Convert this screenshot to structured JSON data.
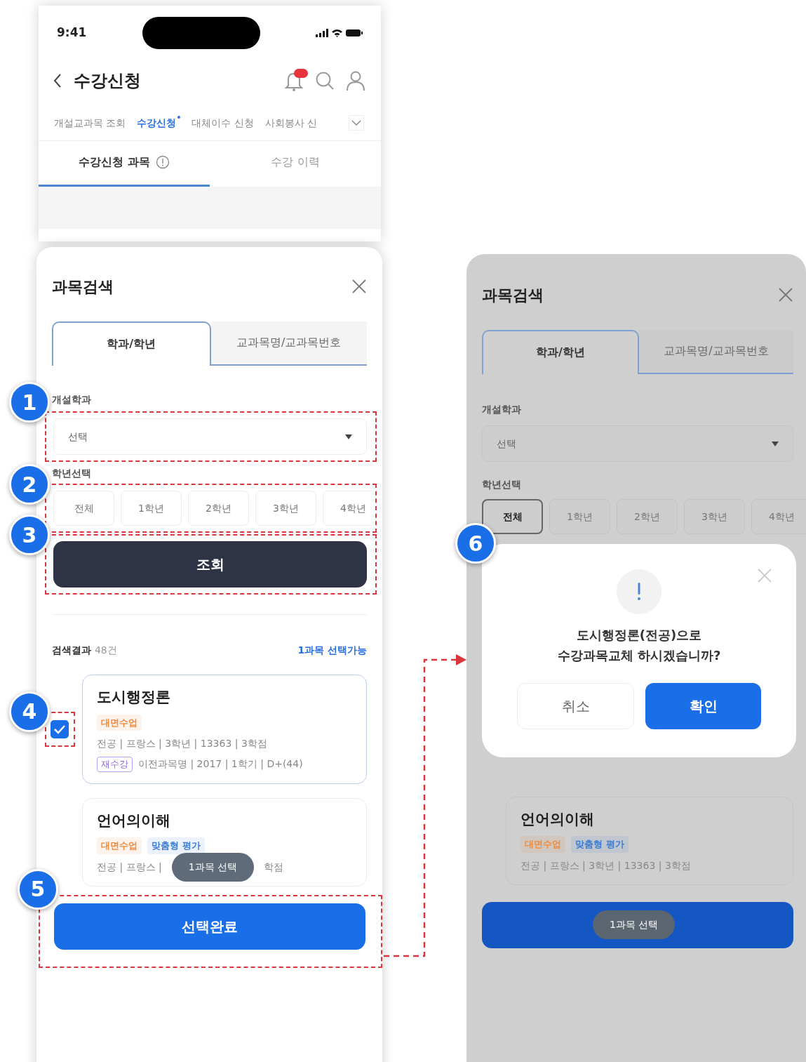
{
  "status_bar": {
    "time": "9:41"
  },
  "app_header": {
    "title": "수강신청"
  },
  "menu_tabs": [
    {
      "label": "개설교과목 조회",
      "selected": false
    },
    {
      "label": "수강신청",
      "selected": true
    },
    {
      "label": "대체이수 신청",
      "selected": false
    },
    {
      "label": "사회봉사 신",
      "selected": false
    }
  ],
  "sub_tabs": [
    {
      "label": "수강신청 과목",
      "selected": true
    },
    {
      "label": "수강 이력",
      "selected": false
    }
  ],
  "search_sheet": {
    "title": "과목검색",
    "tabs": [
      {
        "label": "학과/학년",
        "selected": true
      },
      {
        "label": "교과목명/교과목번호",
        "selected": false
      }
    ],
    "department": {
      "label": "개설학과",
      "value": "선택"
    },
    "grade": {
      "label": "학년선택",
      "options": [
        {
          "label": "전체",
          "selected": false
        },
        {
          "label": "1학년",
          "selected": false
        },
        {
          "label": "2학년",
          "selected": false
        },
        {
          "label": "3학년",
          "selected": false
        },
        {
          "label": "4학년",
          "selected": false
        }
      ]
    },
    "search_button": "조회",
    "results": {
      "label": "검색결과",
      "count": "48건",
      "hint": "1과목 선택가능"
    },
    "courses": [
      {
        "name": "도시행정론",
        "checked": true,
        "tags": [
          {
            "label": "대면수업",
            "color": "#f08a3c"
          }
        ],
        "info": [
          "전공 | 프랑스 | 3학년 | 13363 | 3학점"
        ],
        "retake": {
          "tag": "재수강",
          "info": "이전과목명 | 2017 | 1학기 | D+(44)"
        }
      },
      {
        "name": "언어의이해",
        "checked": false,
        "tags": [
          {
            "label": "대면수업",
            "color": "#f08a3c"
          },
          {
            "label": "맞춤형 평가",
            "color": "#3a7bd5"
          }
        ],
        "info": [
          "전공 | 프랑스 |",
          "학점"
        ]
      }
    ],
    "toast": "1과목 선택",
    "confirm_button": "선택완료"
  },
  "dialog_screen": {
    "title": "과목검색",
    "tabs": [
      {
        "label": "학과/학년",
        "selected": true
      },
      {
        "label": "교과목명/교과목번호",
        "selected": false
      }
    ],
    "department": {
      "label": "개설학과",
      "value": "선택"
    },
    "grade": {
      "label": "학년선택",
      "options": [
        {
          "label": "전체",
          "selected": true
        },
        {
          "label": "1학년",
          "selected": false
        },
        {
          "label": "2학년",
          "selected": false
        },
        {
          "label": "3학년",
          "selected": false
        },
        {
          "label": "4학년",
          "selected": false
        }
      ]
    },
    "dialog": {
      "message": "도시행정론(전공)으로\n수강과목교체 하시겠습니까?",
      "buttons": [
        {
          "label": "취소",
          "kind": "secondary"
        },
        {
          "label": "확인",
          "kind": "primary"
        }
      ]
    },
    "courses": [
      {
        "name": "언어의이해",
        "tags": [
          {
            "label": "대면수업",
            "color": "#f08a3c"
          },
          {
            "label": "맞춤형 평가",
            "color": "#3a7bd5"
          }
        ],
        "info": [
          "전공 | 프랑스 | 3학년 | 13363 | 3학점"
        ]
      }
    ],
    "toast": "1과목 선택"
  },
  "annotations": [
    "1",
    "2",
    "3",
    "4",
    "5",
    "6"
  ]
}
